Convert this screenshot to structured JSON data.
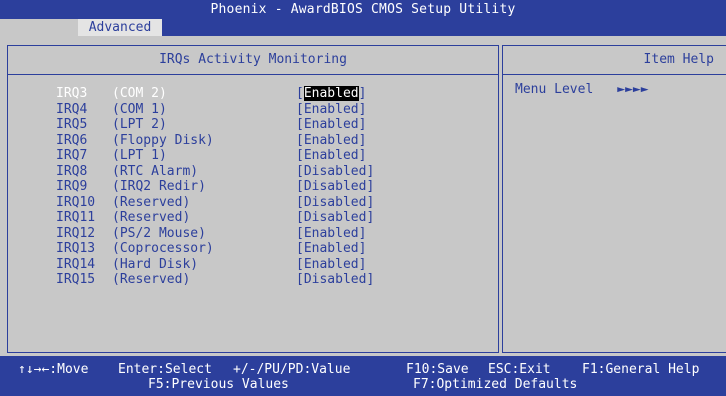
{
  "header": {
    "title": "Phoenix - AwardBIOS CMOS Setup Utility",
    "active_tab": "Advanced"
  },
  "main": {
    "panel_title": "IRQs Activity Monitoring",
    "items": [
      {
        "irq": "IRQ3",
        "device": "(COM 2)",
        "value": "Enabled",
        "selected": true
      },
      {
        "irq": "IRQ4",
        "device": "(COM 1)",
        "value": "Enabled"
      },
      {
        "irq": "IRQ5",
        "device": "(LPT 2)",
        "value": "Enabled"
      },
      {
        "irq": "IRQ6",
        "device": "(Floppy Disk)",
        "value": "Enabled"
      },
      {
        "irq": "IRQ7",
        "device": "(LPT 1)",
        "value": "Enabled"
      },
      {
        "irq": "IRQ8",
        "device": "(RTC Alarm)",
        "value": "Disabled"
      },
      {
        "irq": "IRQ9",
        "device": "(IRQ2 Redir)",
        "value": "Disabled"
      },
      {
        "irq": "IRQ10",
        "device": "(Reserved)",
        "value": "Disabled"
      },
      {
        "irq": "IRQ11",
        "device": "(Reserved)",
        "value": "Disabled"
      },
      {
        "irq": "IRQ12",
        "device": "(PS/2 Mouse)",
        "value": "Enabled"
      },
      {
        "irq": "IRQ13",
        "device": "(Coprocessor)",
        "value": "Enabled"
      },
      {
        "irq": "IRQ14",
        "device": "(Hard Disk)",
        "value": "Enabled"
      },
      {
        "irq": "IRQ15",
        "device": "(Reserved)",
        "value": "Disabled"
      }
    ]
  },
  "help": {
    "panel_title": "Item Help",
    "menu_level_label": "Menu Level",
    "menu_level_arrows": "►►►►"
  },
  "footer": {
    "move": "↑↓→←:Move",
    "select": "Enter:Select",
    "value": "+/-/PU/PD:Value",
    "save": "F10:Save",
    "exit": "ESC:Exit",
    "general_help": "F1:General Help",
    "previous_values": "F5:Previous Values",
    "optimized_defaults": "F7:Optimized Defaults"
  },
  "colors": {
    "bios_blue": "#2c3f9c",
    "background_gray": "#c8c8c8",
    "highlight_black": "#000000",
    "text_white": "#ffffff"
  }
}
